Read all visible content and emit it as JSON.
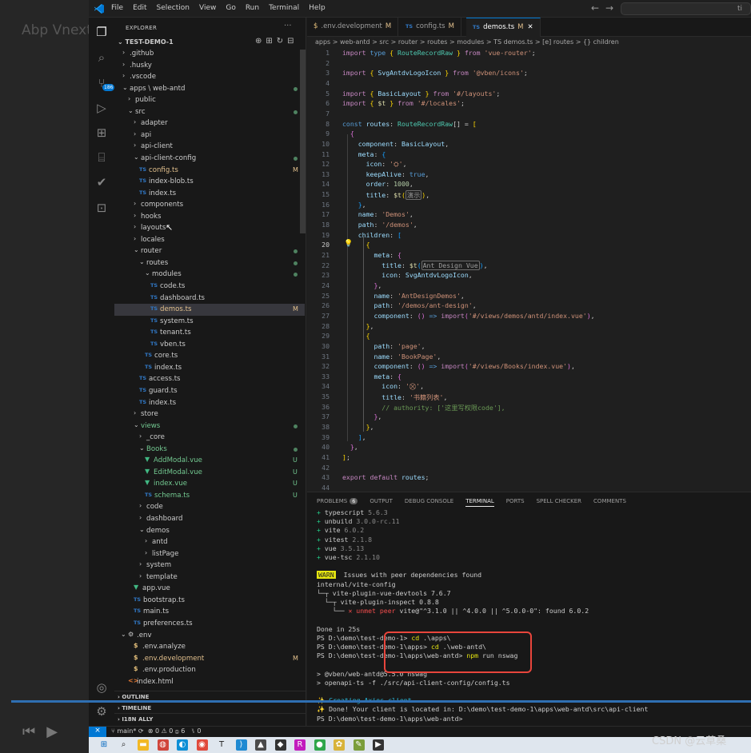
{
  "window": {
    "watermark_overlay": "Abp Vnext Pro",
    "menu": [
      "File",
      "Edit",
      "Selection",
      "View",
      "Go",
      "Run",
      "Terminal",
      "Help"
    ],
    "command_center_tail": "ti"
  },
  "activity": {
    "scm_badge": "186"
  },
  "explorer": {
    "title": "EXPLORER",
    "root": "TEST-DEMO-1",
    "tree": [
      {
        "label": ".github",
        "indent": 0,
        "kind": "folder",
        "open": false
      },
      {
        "label": ".husky",
        "indent": 0,
        "kind": "folder",
        "open": false
      },
      {
        "label": ".vscode",
        "indent": 0,
        "kind": "folder",
        "open": false
      },
      {
        "label": "apps \\ web-antd",
        "indent": 0,
        "kind": "folder",
        "open": true,
        "status": "dot"
      },
      {
        "label": "public",
        "indent": 1,
        "kind": "folder",
        "open": false
      },
      {
        "label": "src",
        "indent": 1,
        "kind": "folder",
        "open": true,
        "status": "dot"
      },
      {
        "label": "adapter",
        "indent": 2,
        "kind": "folder",
        "open": false
      },
      {
        "label": "api",
        "indent": 2,
        "kind": "folder",
        "open": false
      },
      {
        "label": "api-client",
        "indent": 2,
        "kind": "folder",
        "open": false
      },
      {
        "label": "api-client-config",
        "indent": 2,
        "kind": "folder",
        "open": true,
        "status": "dot"
      },
      {
        "label": "config.ts",
        "indent": 3,
        "kind": "ts",
        "status": "M"
      },
      {
        "label": "index-blob.ts",
        "indent": 3,
        "kind": "ts"
      },
      {
        "label": "index.ts",
        "indent": 3,
        "kind": "ts"
      },
      {
        "label": "components",
        "indent": 2,
        "kind": "folder",
        "open": false
      },
      {
        "label": "hooks",
        "indent": 2,
        "kind": "folder",
        "open": false
      },
      {
        "label": "layouts",
        "indent": 2,
        "kind": "folder",
        "open": false,
        "hover": true
      },
      {
        "label": "locales",
        "indent": 2,
        "kind": "folder",
        "open": false
      },
      {
        "label": "router",
        "indent": 2,
        "kind": "folder",
        "open": true,
        "status": "dot"
      },
      {
        "label": "routes",
        "indent": 3,
        "kind": "folder",
        "open": true,
        "status": "dot"
      },
      {
        "label": "modules",
        "indent": 4,
        "kind": "folder",
        "open": true,
        "status": "dot"
      },
      {
        "label": "code.ts",
        "indent": 5,
        "kind": "ts"
      },
      {
        "label": "dashboard.ts",
        "indent": 5,
        "kind": "ts"
      },
      {
        "label": "demos.ts",
        "indent": 5,
        "kind": "ts",
        "status": "M",
        "selected": true
      },
      {
        "label": "system.ts",
        "indent": 5,
        "kind": "ts"
      },
      {
        "label": "tenant.ts",
        "indent": 5,
        "kind": "ts"
      },
      {
        "label": "vben.ts",
        "indent": 5,
        "kind": "ts"
      },
      {
        "label": "core.ts",
        "indent": 4,
        "kind": "ts"
      },
      {
        "label": "index.ts",
        "indent": 4,
        "kind": "ts"
      },
      {
        "label": "access.ts",
        "indent": 3,
        "kind": "ts"
      },
      {
        "label": "guard.ts",
        "indent": 3,
        "kind": "ts"
      },
      {
        "label": "index.ts",
        "indent": 3,
        "kind": "ts"
      },
      {
        "label": "store",
        "indent": 2,
        "kind": "folder",
        "open": false
      },
      {
        "label": "views",
        "indent": 2,
        "kind": "folder",
        "open": true,
        "status": "dot",
        "color": "new"
      },
      {
        "label": "_core",
        "indent": 3,
        "kind": "folder",
        "open": false
      },
      {
        "label": "Books",
        "indent": 3,
        "kind": "folder",
        "open": true,
        "status": "dot",
        "color": "new"
      },
      {
        "label": "AddModal.vue",
        "indent": 4,
        "kind": "vue",
        "status": "U",
        "color": "new"
      },
      {
        "label": "EditModal.vue",
        "indent": 4,
        "kind": "vue",
        "status": "U",
        "color": "new"
      },
      {
        "label": "index.vue",
        "indent": 4,
        "kind": "vue",
        "status": "U",
        "color": "new"
      },
      {
        "label": "schema.ts",
        "indent": 4,
        "kind": "ts",
        "status": "U",
        "color": "new"
      },
      {
        "label": "code",
        "indent": 3,
        "kind": "folder",
        "open": false
      },
      {
        "label": "dashboard",
        "indent": 3,
        "kind": "folder",
        "open": false
      },
      {
        "label": "demos",
        "indent": 3,
        "kind": "folder",
        "open": true
      },
      {
        "label": "antd",
        "indent": 4,
        "kind": "folder",
        "open": false
      },
      {
        "label": "listPage",
        "indent": 4,
        "kind": "folder",
        "open": false
      },
      {
        "label": "system",
        "indent": 3,
        "kind": "folder",
        "open": false
      },
      {
        "label": "template",
        "indent": 3,
        "kind": "folder",
        "open": false
      },
      {
        "label": "app.vue",
        "indent": 2,
        "kind": "vue"
      },
      {
        "label": "bootstrap.ts",
        "indent": 2,
        "kind": "ts"
      },
      {
        "label": "main.ts",
        "indent": 2,
        "kind": "ts"
      },
      {
        "label": "preferences.ts",
        "indent": 2,
        "kind": "ts"
      },
      {
        "label": ".env",
        "indent": 1,
        "kind": "gear",
        "open": true
      },
      {
        "label": ".env.analyze",
        "indent": 2,
        "kind": "env"
      },
      {
        "label": ".env.development",
        "indent": 2,
        "kind": "env",
        "status": "M"
      },
      {
        "label": ".env.production",
        "indent": 2,
        "kind": "env"
      },
      {
        "label": "index.html",
        "indent": 1,
        "kind": "html"
      }
    ],
    "sections": [
      "OUTLINE",
      "TIMELINE",
      "I18N ALLY"
    ]
  },
  "tabs": [
    {
      "label": ".env.development",
      "icon": "$",
      "modified": "M"
    },
    {
      "label": "config.ts",
      "icon": "TS",
      "modified": "M"
    },
    {
      "label": "demos.ts",
      "icon": "TS",
      "modified": "M",
      "active": true
    }
  ],
  "breadcrumb": "apps > web-antd > src > router > routes > modules > TS demos.ts > [e] routes > {} children",
  "code": [
    {
      "n": 1,
      "html": "<span class='k'>import</span> <span class='kw'>type</span> <span class='b1'>{</span> <span class='t'>RouteRecordRaw</span> <span class='b1'>}</span> <span class='k'>from</span> <span class='s'>'vue-router'</span><span class='p'>;</span>"
    },
    {
      "n": 2,
      "html": ""
    },
    {
      "n": 3,
      "html": "<span class='k'>import</span> <span class='b1'>{</span> <span class='v'>SvgAntdvLogoIcon</span> <span class='b1'>}</span> <span class='k'>from</span> <span class='s'>'@vben/icons'</span><span class='p'>;</span>"
    },
    {
      "n": 4,
      "html": ""
    },
    {
      "n": 5,
      "html": "<span class='k'>import</span> <span class='b1'>{</span> <span class='v'>BasicLayout</span> <span class='b1'>}</span> <span class='k'>from</span> <span class='s'>'#/layouts'</span><span class='p'>;</span>"
    },
    {
      "n": 6,
      "html": "<span class='k'>import</span> <span class='b1'>{</span> <span class='f'>$t</span> <span class='b1'>}</span> <span class='k'>from</span> <span class='s'>'#/locales'</span><span class='p'>;</span>"
    },
    {
      "n": 7,
      "html": ""
    },
    {
      "n": 8,
      "html": "<span class='kw'>const</span> <span class='v'>routes</span><span class='p'>:</span> <span class='t'>RouteRecordRaw</span><span class='p'>[]</span> <span class='p'>=</span> <span class='b1'>[</span>"
    },
    {
      "n": 9,
      "html": "  <span class='b2'>{</span>"
    },
    {
      "n": 10,
      "html": "    <span class='v'>component</span><span class='p'>:</span> <span class='v'>BasicLayout</span><span class='p'>,</span>"
    },
    {
      "n": 11,
      "html": "    <span class='v'>meta</span><span class='p'>:</span> <span class='b3'>{</span>"
    },
    {
      "n": 12,
      "html": "      <span class='v'>icon</span><span class='p'>:</span> <span class='s'>'⛭'</span><span class='p'>,</span>"
    },
    {
      "n": 13,
      "html": "      <span class='v'>keepAlive</span><span class='p'>:</span> <span class='kw'>true</span><span class='p'>,</span>"
    },
    {
      "n": 14,
      "html": "      <span class='v'>order</span><span class='p'>:</span> <span class='n'>1000</span><span class='p'>,</span>"
    },
    {
      "n": 15,
      "html": "      <span class='v'>title</span><span class='p'>:</span> <span class='f'>$t</span><span class='b1'>(</span><span class='inlay'>演示</span><span class='b1'>)</span><span class='p'>,</span>"
    },
    {
      "n": 16,
      "html": "    <span class='b3'>}</span><span class='p'>,</span>"
    },
    {
      "n": 17,
      "html": "    <span class='v'>name</span><span class='p'>:</span> <span class='s'>'Demos'</span><span class='p'>,</span>"
    },
    {
      "n": 18,
      "html": "    <span class='v'>path</span><span class='p'>:</span> <span class='s'>'/demos'</span><span class='p'>,</span>"
    },
    {
      "n": 19,
      "html": "    <span class='v'>children</span><span class='p'>:</span> <span class='b3'>[</span>"
    },
    {
      "n": 20,
      "html": "      <span class='b1'>{</span>",
      "current": true
    },
    {
      "n": 21,
      "html": "        <span class='v'>meta</span><span class='p'>:</span> <span class='b2'>{</span>"
    },
    {
      "n": 22,
      "html": "          <span class='v'>title</span><span class='p'>:</span> <span class='f'>$t</span><span class='b3'>(</span><span class='inlay'>Ant Design Vue</span><span class='b3'>)</span><span class='p'>,</span>"
    },
    {
      "n": 23,
      "html": "          <span class='v'>icon</span><span class='p'>:</span> <span class='v'>SvgAntdvLogoIcon</span><span class='p'>,</span>"
    },
    {
      "n": 24,
      "html": "        <span class='b2'>}</span><span class='p'>,</span>"
    },
    {
      "n": 25,
      "html": "        <span class='v'>name</span><span class='p'>:</span> <span class='s'>'AntDesignDemos'</span><span class='p'>,</span>"
    },
    {
      "n": 26,
      "html": "        <span class='v'>path</span><span class='p'>:</span> <span class='s'>'/demos/ant-design'</span><span class='p'>,</span>"
    },
    {
      "n": 27,
      "html": "        <span class='v'>component</span><span class='p'>:</span> <span class='b2'>()</span> <span class='kw'>=&gt;</span> <span class='k'>import</span><span class='b2'>(</span><span class='s'>'#/views/demos/antd/index.vue'</span><span class='b2'>)</span><span class='p'>,</span>"
    },
    {
      "n": 28,
      "html": "      <span class='b1'>}</span><span class='p'>,</span>"
    },
    {
      "n": 29,
      "html": "      <span class='b1'>{</span>"
    },
    {
      "n": 30,
      "html": "        <span class='v'>path</span><span class='p'>:</span> <span class='s'>'page'</span><span class='p'>,</span>"
    },
    {
      "n": 31,
      "html": "        <span class='v'>name</span><span class='p'>:</span> <span class='s'>'BookPage'</span><span class='p'>,</span>"
    },
    {
      "n": 32,
      "html": "        <span class='v'>component</span><span class='p'>:</span> <span class='b2'>()</span> <span class='kw'>=&gt;</span> <span class='k'>import</span><span class='b2'>(</span><span class='s'>'#/views/Books/index.vue'</span><span class='b2'>)</span><span class='p'>,</span>"
    },
    {
      "n": 33,
      "html": "        <span class='v'>meta</span><span class='p'>:</span> <span class='b2'>{</span>"
    },
    {
      "n": 34,
      "html": "          <span class='v'>icon</span><span class='p'>:</span> <span class='s'>'⛒'</span><span class='p'>,</span>"
    },
    {
      "n": 35,
      "html": "          <span class='v'>title</span><span class='p'>:</span> <span class='s'>'书籍列表'</span><span class='p'>,</span>"
    },
    {
      "n": 36,
      "html": "          <span class='cm'>// authority: ['这里写权限code'],</span>"
    },
    {
      "n": 37,
      "html": "        <span class='b2'>}</span><span class='p'>,</span>"
    },
    {
      "n": 38,
      "html": "      <span class='b1'>}</span><span class='p'>,</span>"
    },
    {
      "n": 39,
      "html": "    <span class='b3'>]</span><span class='p'>,</span>"
    },
    {
      "n": 40,
      "html": "  <span class='b2'>}</span><span class='p'>,</span>"
    },
    {
      "n": 41,
      "html": "<span class='b1'>]</span><span class='p'>;</span>"
    },
    {
      "n": 42,
      "html": ""
    },
    {
      "n": 43,
      "html": "<span class='k'>export</span> <span class='k'>default</span> <span class='v'>routes</span><span class='p'>;</span>"
    },
    {
      "n": 44,
      "html": ""
    }
  ],
  "panel": {
    "tabs": [
      "PROBLEMS",
      "OUTPUT",
      "DEBUG CONSOLE",
      "TERMINAL",
      "PORTS",
      "SPELL CHECKER",
      "COMMENTS"
    ],
    "problems_count": "6",
    "active_tab": "TERMINAL",
    "terminal": [
      "<span class='tg'>+</span> typescript <span class='tgray'>5.6.3</span>",
      "<span class='tg'>+</span> unbuild <span class='tgray'>3.0.0-rc.11</span>",
      "<span class='tg'>+</span> vite <span class='tgray'>6.0.2</span>",
      "<span class='tg'>+</span> vitest <span class='tgray'>2.1.8</span>",
      "<span class='tg'>+</span> vue <span class='tgray'>3.5.13</span>",
      "<span class='tg'>+</span> vue-tsc <span class='tgray'>2.1.10</span>",
      "",
      "<span class='tw'>WARN</span>  Issues with peer dependencies found",
      "internal/vite-config",
      "└─┬ vite-plugin-vue-devtools 7.6.7",
      "  └─┬ vite-plugin-inspect 0.8.8",
      "    └── <span class='tr'>✕ unmet peer</span> vite@\"^3.1.0 || ^4.0.0 || ^5.0.0-0\": found 6.0.2",
      "",
      "Done in 25s",
      "PS D:\\demo\\test-demo-1&gt; <span class='ty'>cd</span> .\\apps\\",
      "PS D:\\demo\\test-demo-1\\apps&gt; <span class='ty'>cd</span> .\\web-antd\\",
      "PS D:\\demo\\test-demo-1\\apps\\web-antd&gt; <span class='ty'>npm</span> run nswag",
      "",
      "&gt; @vben/web-antd@5.5.0 nswag",
      "&gt; openapi-ts -f ./src/api-client-config/config.ts",
      "",
      "<span class='ty'>✨</span> <span class='tc'>Creating Axios client</span>",
      "<span class='ty'>✨</span> Done! Your client is located in: D:\\demo\\test-demo-1\\apps\\web-antd\\src\\api-client",
      "PS D:\\demo\\test-demo-1\\apps\\web-antd&gt;"
    ]
  },
  "status": {
    "remote_icon": "⨯",
    "branch": "main*",
    "sync": "⟳",
    "problems": "⊗ 0 ⚠ 0 ⓘ 6",
    "ports": "⑊ 0"
  },
  "taskbar_icons": [
    {
      "name": "windows-start-icon",
      "glyph": "⊞",
      "color": "#0067c0"
    },
    {
      "name": "search-icon",
      "glyph": "⌕",
      "color": "#333"
    },
    {
      "name": "file-explorer-icon",
      "glyph": "▬",
      "color": "#f2b824"
    },
    {
      "name": "app-icon",
      "glyph": "◍",
      "color": "#d0453b"
    },
    {
      "name": "edge-icon",
      "glyph": "◐",
      "color": "#0d8fd6"
    },
    {
      "name": "chrome-icon",
      "glyph": "◉",
      "color": "#e0483a"
    },
    {
      "name": "typora-icon",
      "glyph": "T",
      "color": "#333"
    },
    {
      "name": "vscode-icon",
      "glyph": "⟩",
      "color": "#1f8ad2"
    },
    {
      "name": "app-icon",
      "glyph": "▲",
      "color": "#4a4a4a"
    },
    {
      "name": "app-icon",
      "glyph": "◆",
      "color": "#333"
    },
    {
      "name": "rider-icon",
      "glyph": "R",
      "color": "#c21bbd"
    },
    {
      "name": "app-icon",
      "glyph": "●",
      "color": "#2fa64a"
    },
    {
      "name": "app-icon",
      "glyph": "✿",
      "color": "#d8b33a"
    },
    {
      "name": "app-icon",
      "glyph": "✎",
      "color": "#7b9e3b"
    },
    {
      "name": "terminal-icon",
      "glyph": "▶",
      "color": "#333"
    }
  ],
  "watermark": "CSDN @云草桑"
}
